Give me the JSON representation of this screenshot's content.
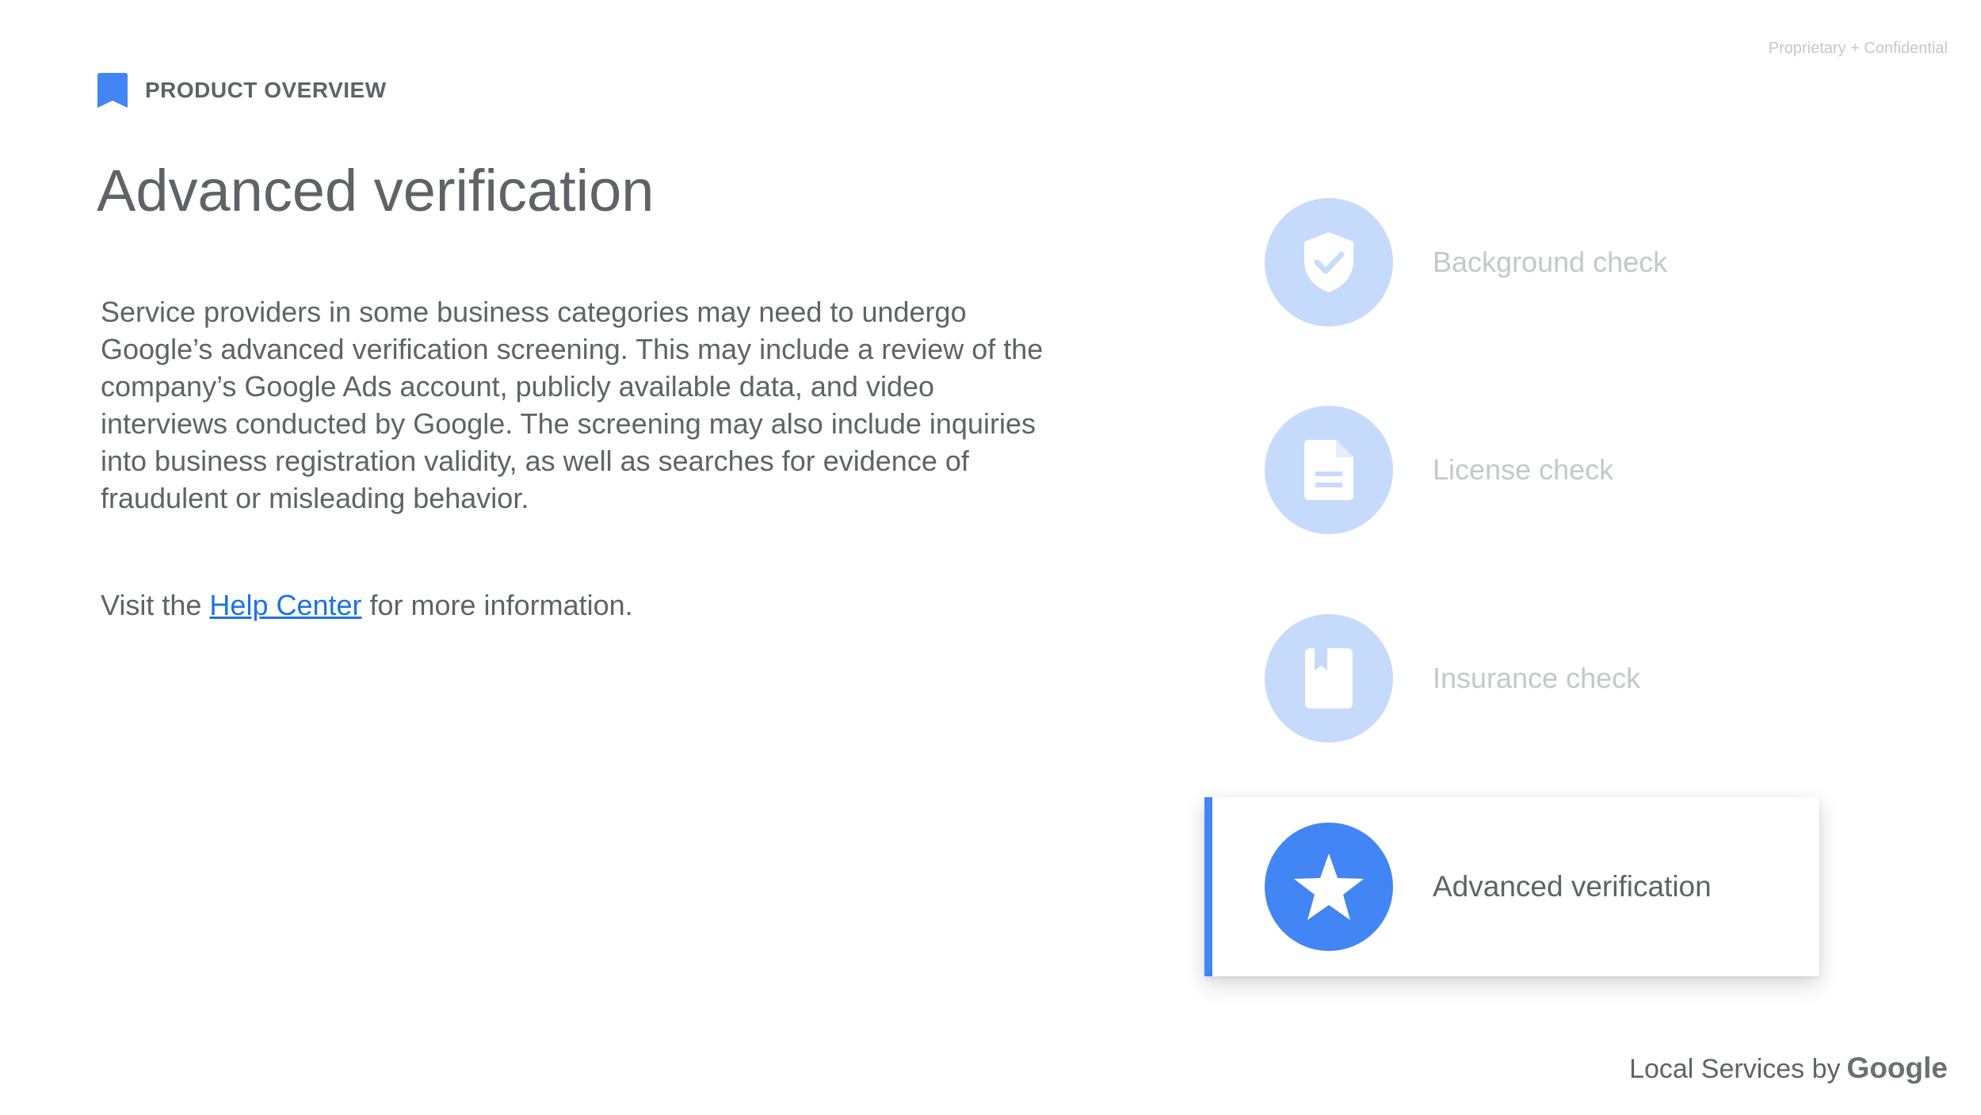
{
  "header": {
    "confidential": "Proprietary + Confidential",
    "eyebrow": "PRODUCT OVERVIEW",
    "title": "Advanced verification"
  },
  "content": {
    "paragraph": "Service providers in some business categories may need to undergo Google’s advanced verification screening. This may include a review of the company’s Google Ads account, publicly available data, and video interviews conducted by Google. The screening may also include inquiries into business registration validity, as well as searches for evidence of fraudulent or misleading behavior.",
    "visit_prefix": "Visit the ",
    "visit_link": "Help Center",
    "visit_suffix": " for more information."
  },
  "checklist": [
    {
      "label": "Background check",
      "icon": "shield-check-icon",
      "active": false
    },
    {
      "label": "License check",
      "icon": "document-icon",
      "active": false
    },
    {
      "label": "Insurance check",
      "icon": "book-icon",
      "active": false
    },
    {
      "label": "Advanced verification",
      "icon": "star-icon",
      "active": true
    }
  ],
  "footer": {
    "text": "Local Services by",
    "brand": "Google"
  },
  "colors": {
    "accent": "#4285f4",
    "inactive_circle": "#c6dafc",
    "link": "#1a73e8",
    "text": "#5f6368",
    "muted": "#c4c7cc"
  }
}
